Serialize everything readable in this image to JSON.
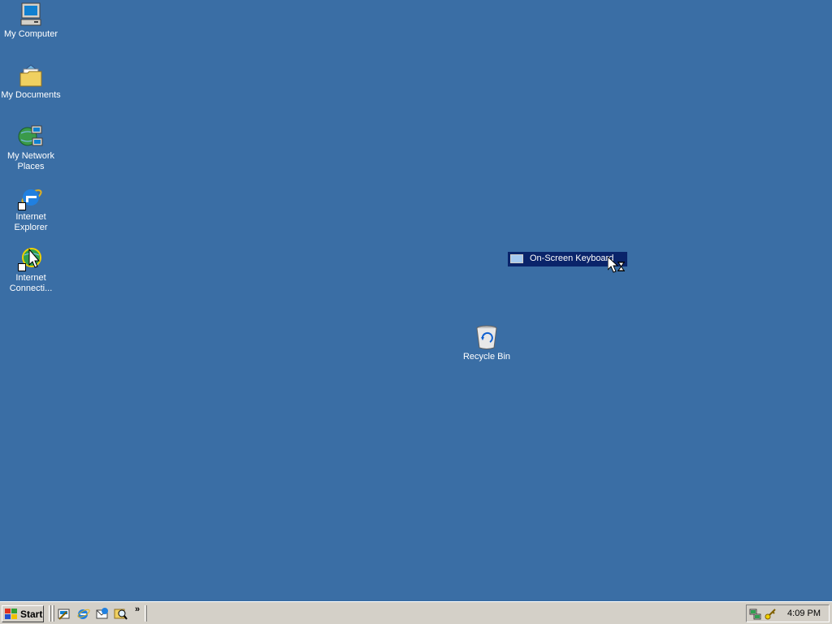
{
  "desktop": {
    "background": "#3a6ea5",
    "icons": [
      {
        "name": "my-computer",
        "label": "My Computer"
      },
      {
        "name": "my-documents",
        "label": "My Documents"
      },
      {
        "name": "my-network-places",
        "label": "My Network Places"
      },
      {
        "name": "internet-explorer",
        "label": "Internet Explorer"
      },
      {
        "name": "internet-connection",
        "label": "Internet Connecti..."
      },
      {
        "name": "recycle-bin",
        "label": "Recycle Bin"
      }
    ]
  },
  "drag_window": {
    "title": "On-Screen Keyboard",
    "icon": "keyboard-icon"
  },
  "cursor": {
    "icon": "arrow-busy-cursor"
  },
  "taskbar": {
    "start_label": "Start",
    "quick_launch": [
      "show-desktop-icon",
      "internet-explorer-icon",
      "outlook-express-icon",
      "search-icon"
    ],
    "chevron": "»",
    "tray_icons": [
      "network-icon",
      "key-icon"
    ],
    "clock": "4:09 PM"
  }
}
